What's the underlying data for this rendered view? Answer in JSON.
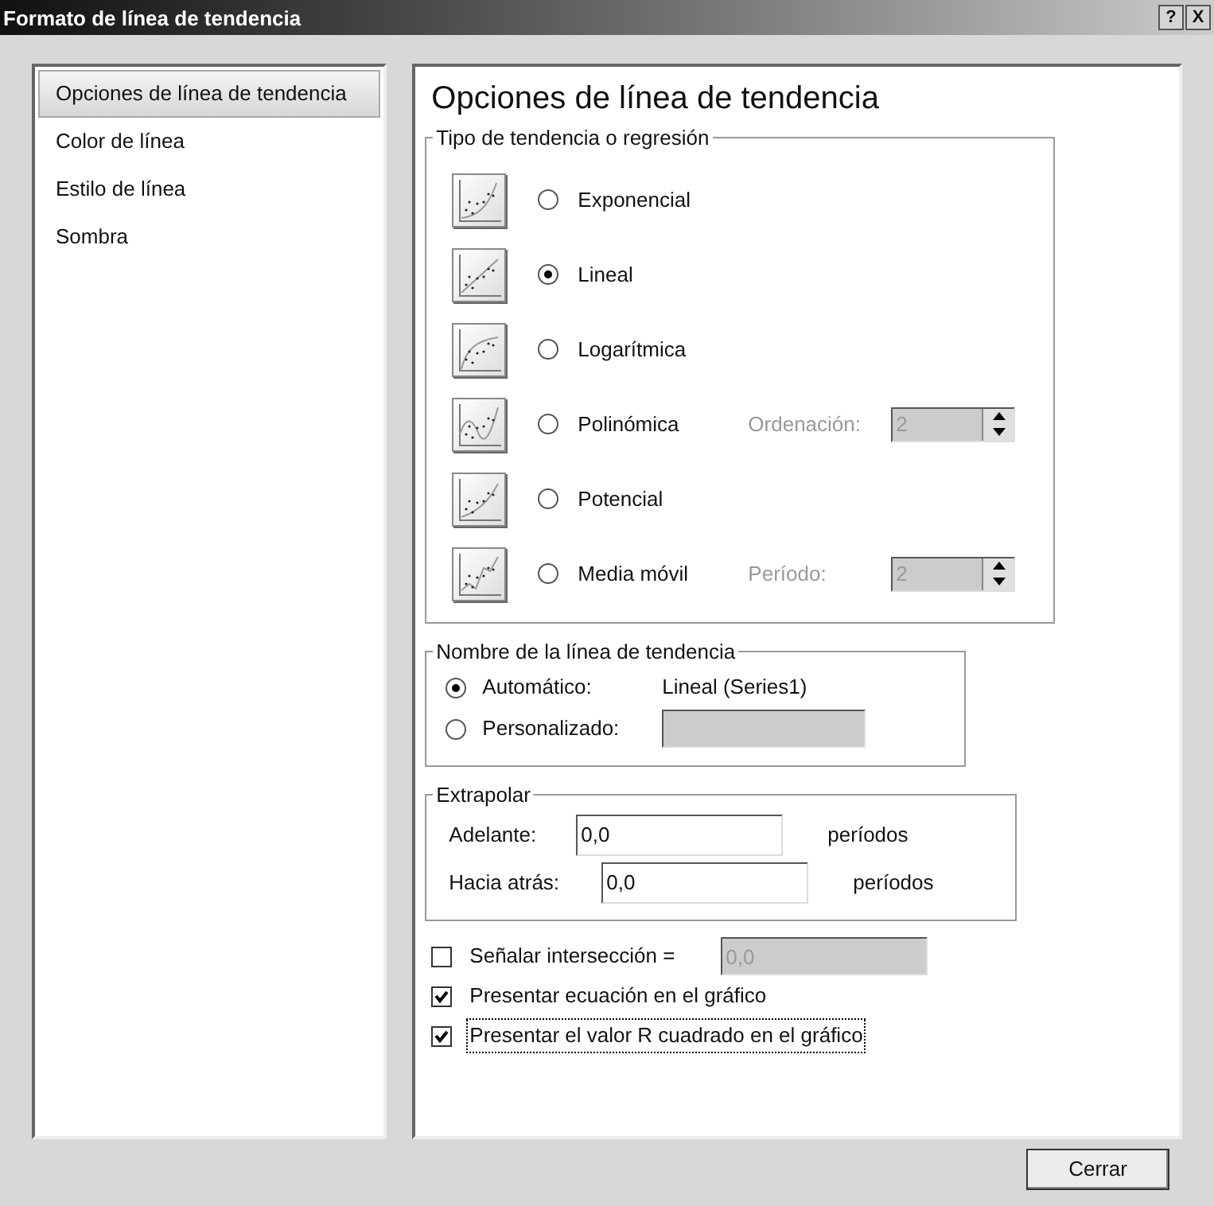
{
  "window": {
    "title": "Formato de línea de tendencia",
    "buttons": [
      "?",
      "X"
    ]
  },
  "sidebar": {
    "items": [
      {
        "label": "Opciones de línea de tendencia",
        "selected": true
      },
      {
        "label": "Color de línea",
        "selected": false
      },
      {
        "label": "Estilo de línea",
        "selected": false
      },
      {
        "label": "Sombra",
        "selected": false
      }
    ]
  },
  "panel": {
    "heading": "Opciones de línea de tendencia",
    "trend_type": {
      "legend": "Tipo de tendencia o regresión",
      "options": [
        {
          "label": "Exponencial",
          "kind": "exponential",
          "selected": false
        },
        {
          "label": "Lineal",
          "kind": "linear",
          "selected": true
        },
        {
          "label": "Logarítmica",
          "kind": "logarithmic",
          "selected": false
        },
        {
          "label": "Polinómica",
          "kind": "polynomial",
          "selected": false,
          "param": {
            "label": "Ordenación:",
            "value": "2",
            "disabled": true
          }
        },
        {
          "label": "Potencial",
          "kind": "power",
          "selected": false
        },
        {
          "label": "Media móvil",
          "kind": "moving_average",
          "selected": false,
          "param": {
            "label": "Período:",
            "value": "2",
            "disabled": true
          }
        }
      ]
    },
    "trend_name": {
      "legend": "Nombre de la línea de tendencia",
      "options": [
        {
          "label": "Automático:",
          "selected": true,
          "kind": "text",
          "value": "Lineal (Series1)"
        },
        {
          "label": "Personalizado:",
          "selected": false,
          "kind": "field",
          "disabled": true
        }
      ]
    },
    "extrapolate": {
      "legend": "Extrapolar",
      "rows": [
        {
          "label": "Adelante:",
          "value": "0,0",
          "unit": "períodos"
        },
        {
          "label": "Hacia atrás:",
          "value": "0,0",
          "unit": "períodos"
        }
      ]
    },
    "checks": [
      {
        "label": "Señalar intersección =",
        "checked": false,
        "field": {
          "value": "0,0",
          "disabled": true
        }
      },
      {
        "label": "Presentar ecuación en el gráfico",
        "checked": true,
        "focused": false
      },
      {
        "label": "Presentar el valor R cuadrado en el gráfico",
        "checked": true,
        "focused": true
      }
    ]
  },
  "footer": {
    "button": "Cerrar"
  }
}
